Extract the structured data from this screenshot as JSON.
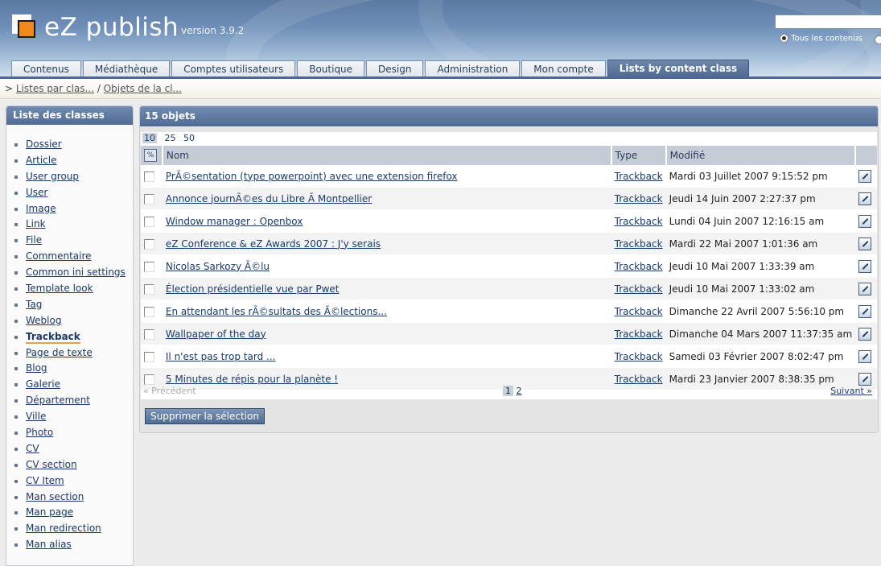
{
  "header": {
    "brand": "eZ publish",
    "version": "version 3.9.2",
    "search_value": "",
    "search_scope_label": "Tous les contenus"
  },
  "tabs": [
    {
      "label": "Contenus"
    },
    {
      "label": "Médiathèque"
    },
    {
      "label": "Comptes utilisateurs"
    },
    {
      "label": "Boutique"
    },
    {
      "label": "Design"
    },
    {
      "label": "Administration"
    },
    {
      "label": "Mon compte"
    },
    {
      "label": "Lists by content class",
      "active": true
    }
  ],
  "breadcrumb": {
    "prefix": ">",
    "items": [
      "Listes par clas...",
      "Objets de la cl..."
    ],
    "separator": "/"
  },
  "sidebar": {
    "title": "Liste des classes",
    "current": "Trackback",
    "items": [
      "Dossier",
      "Article",
      "User group",
      "User",
      "Image",
      "Link",
      "File",
      "Commentaire",
      "Common ini settings",
      "Template look",
      "Tag",
      "Weblog",
      "Trackback",
      "Page de texte",
      "Blog",
      "Galerie",
      "Département",
      "Ville",
      "Photo",
      "CV",
      "CV section",
      "CV Item",
      "Man section",
      "Man page",
      "Man redirection",
      "Man alias"
    ]
  },
  "main": {
    "title": "15 objets",
    "limits": [
      "10",
      "25",
      "50"
    ],
    "limit_selected": "10",
    "columns": {
      "toggle": "",
      "name": "Nom",
      "type": "Type",
      "modified": "Modifié"
    },
    "rows": [
      {
        "name": "PrÃ©sentation (type powerpoint) avec une extension firefox",
        "type": "Trackback",
        "modified": "Mardi 03 Juillet 2007 9:15:52 pm"
      },
      {
        "name": "Annonce journÃ©es du Libre Ã  Montpellier",
        "type": "Trackback",
        "modified": "Jeudi 14 Juin 2007 2:27:37 pm"
      },
      {
        "name": "Window manager : Openbox",
        "type": "Trackback",
        "modified": "Lundi 04 Juin 2007 12:16:15 am"
      },
      {
        "name": "eZ Conference & eZ Awards 2007 : J'y serais",
        "type": "Trackback",
        "modified": "Mardi 22 Mai 2007 1:01:36 am"
      },
      {
        "name": "Nicolas Sarkozy Ã©lu",
        "type": "Trackback",
        "modified": "Jeudi 10 Mai 2007 1:33:39 am"
      },
      {
        "name": "Élection présidentielle vue par Pwet",
        "type": "Trackback",
        "modified": "Jeudi 10 Mai 2007 1:33:02 am"
      },
      {
        "name": "En attendant les rÃ©sultats des Ã©lections...",
        "type": "Trackback",
        "modified": "Dimanche 22 Avril 2007 5:56:10 pm"
      },
      {
        "name": "Wallpaper of the day",
        "type": "Trackback",
        "modified": "Dimanche 04 Mars 2007 11:37:35 am"
      },
      {
        "name": "Il n'est pas trop tard ...",
        "type": "Trackback",
        "modified": "Samedi 03 Février 2007 8:02:47 pm"
      },
      {
        "name": "5 Minutes de répis pour la planète !",
        "type": "Trackback",
        "modified": "Mardi 23 Janvier 2007 8:38:35 pm"
      }
    ],
    "pager": {
      "prev": "« Précédent",
      "pages": [
        "1",
        "2"
      ],
      "current": "1",
      "next": "Suivant »"
    },
    "delete_label": "Supprimer la sélection"
  }
}
